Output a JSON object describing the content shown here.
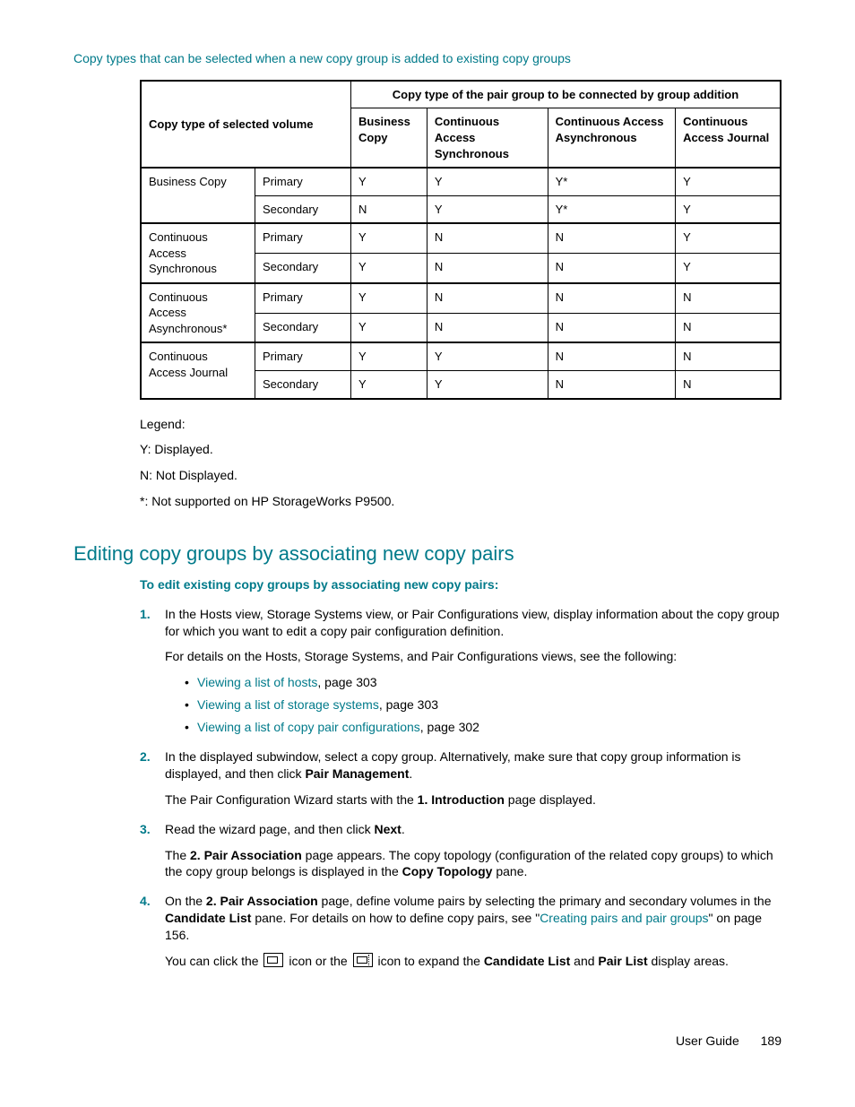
{
  "caption": "Copy types that can be selected when a new copy group is added to existing copy groups",
  "table": {
    "superheader": "Copy type of the pair group to be connected by group addition",
    "rowheader": "Copy type of selected volume",
    "cols": [
      "Business Copy",
      "Continuous Access Synchronous",
      "Continuous Access Asynchronous",
      "Continuous Access Journal"
    ],
    "rows": [
      {
        "name": "Business Copy",
        "sub": [
          {
            "label": "Primary",
            "vals": [
              "Y",
              "Y",
              "Y*",
              "Y"
            ]
          },
          {
            "label": "Secondary",
            "vals": [
              "N",
              "Y",
              "Y*",
              "Y"
            ]
          }
        ]
      },
      {
        "name": "Continuous Access Synchronous",
        "sub": [
          {
            "label": "Primary",
            "vals": [
              "Y",
              "N",
              "N",
              "Y"
            ]
          },
          {
            "label": "Secondary",
            "vals": [
              "Y",
              "N",
              "N",
              "Y"
            ]
          }
        ]
      },
      {
        "name": "Continuous Access Asynchronous*",
        "sub": [
          {
            "label": "Primary",
            "vals": [
              "Y",
              "N",
              "N",
              "N"
            ]
          },
          {
            "label": "Secondary",
            "vals": [
              "Y",
              "N",
              "N",
              "N"
            ]
          }
        ]
      },
      {
        "name": "Continuous Access Journal",
        "sub": [
          {
            "label": "Primary",
            "vals": [
              "Y",
              "Y",
              "N",
              "N"
            ]
          },
          {
            "label": "Secondary",
            "vals": [
              "Y",
              "Y",
              "N",
              "N"
            ]
          }
        ]
      }
    ]
  },
  "legend": {
    "title": "Legend:",
    "items": [
      "Y: Displayed.",
      "N: Not Displayed.",
      "*: Not supported on HP StorageWorks P9500."
    ]
  },
  "section_title": "Editing copy groups by associating new copy pairs",
  "subhead": "To edit existing copy groups by associating new copy pairs:",
  "steps": {
    "s1": {
      "text": "In the Hosts view, Storage Systems view, or Pair Configurations view, display information about the copy group for which you want to edit a copy pair configuration definition.",
      "text2": "For details on the Hosts, Storage Systems, and Pair Configurations views, see the following:",
      "links": [
        {
          "text": "Viewing a list of hosts",
          "page": ", page 303"
        },
        {
          "text": "Viewing a list of storage systems",
          "page": ", page 303"
        },
        {
          "text": "Viewing a list of copy pair configurations",
          "page": ", page 302"
        }
      ]
    },
    "s2": {
      "pre": "In the displayed subwindow, select a copy group. Alternatively, make sure that copy group information is displayed, and then click ",
      "bold": "Pair Management",
      "post": ".",
      "sub_pre": "The Pair Configuration Wizard starts with the ",
      "sub_bold": "1. Introduction",
      "sub_post": " page displayed."
    },
    "s3": {
      "pre": "Read the wizard page, and then click ",
      "bold": "Next",
      "post": ".",
      "sub_pre1": "The ",
      "sub_b1": "2. Pair Association",
      "sub_mid": " page appears. The copy topology (configuration of the related copy groups) to which the copy group belongs is displayed in the ",
      "sub_b2": "Copy Topology",
      "sub_post": " pane."
    },
    "s4": {
      "pre": "On the ",
      "b1": "2. Pair Association",
      "mid1": " page, define volume pairs by selecting the primary and secondary volumes in the ",
      "b2": "Candidate List",
      "mid2": " pane. For details on how to define copy pairs, see \"",
      "link": "Creating pairs and pair groups",
      "post": "\" on page 156.",
      "p2_pre": "You can click the ",
      "p2_mid": " icon or the ",
      "p2_mid2": " icon to expand the ",
      "p2_b1": "Candidate List",
      "p2_and": " and ",
      "p2_b2": "Pair List",
      "p2_post": " display areas."
    }
  },
  "footer": {
    "label": "User Guide",
    "page": "189"
  }
}
